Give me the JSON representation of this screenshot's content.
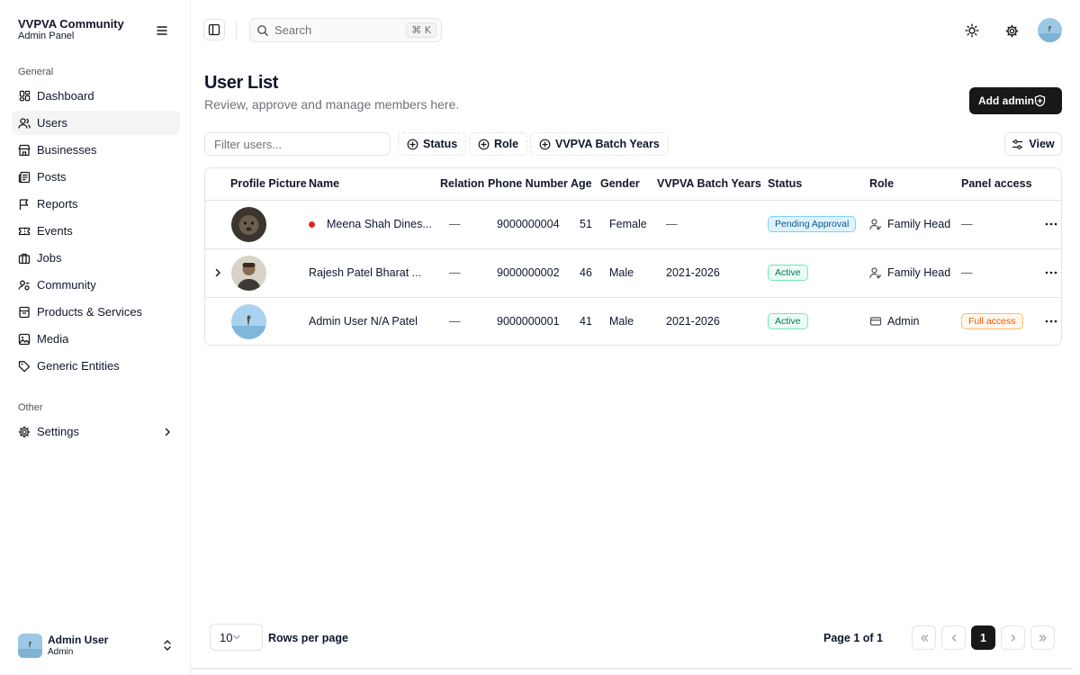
{
  "sidebar": {
    "title": "VVPVA Community",
    "subtitle": "Admin Panel",
    "group_general": "General",
    "group_other": "Other",
    "items": [
      {
        "label": "Dashboard",
        "icon": "dashboard-icon"
      },
      {
        "label": "Users",
        "icon": "users-icon",
        "active": true
      },
      {
        "label": "Businesses",
        "icon": "store-icon"
      },
      {
        "label": "Posts",
        "icon": "newspaper-icon"
      },
      {
        "label": "Reports",
        "icon": "flag-icon"
      },
      {
        "label": "Events",
        "icon": "ticket-icon"
      },
      {
        "label": "Jobs",
        "icon": "briefcase-icon"
      },
      {
        "label": "Community",
        "icon": "user-group-icon"
      },
      {
        "label": "Products & Services",
        "icon": "package-icon"
      },
      {
        "label": "Media",
        "icon": "image-icon"
      },
      {
        "label": "Generic Entities",
        "icon": "tag-icon"
      }
    ],
    "other_items": [
      {
        "label": "Settings",
        "icon": "gear-icon"
      }
    ],
    "user": {
      "name": "Admin User",
      "role": "Admin"
    }
  },
  "header": {
    "search_placeholder": "Search",
    "search_shortcut": "⌘ K"
  },
  "main": {
    "title": "User List",
    "subtitle": "Review, approve and manage members here.",
    "add_admin_label": "Add admin",
    "filter_placeholder": "Filter users...",
    "filter_chips": [
      "Status",
      "Role",
      "VVPVA Batch Years"
    ],
    "view_label": "View"
  },
  "table": {
    "columns": [
      "Profile Picture",
      "Name",
      "Relation",
      "Phone Number",
      "Age",
      "Gender",
      "VVPVA Batch Years",
      "Status",
      "Role",
      "Panel access"
    ],
    "rows": [
      {
        "name": "Meena Shah Dines...",
        "relation": "—",
        "phone": "9000000004",
        "age": "51",
        "gender": "Female",
        "batch": "—",
        "status": "Pending Approval",
        "role": "Family Head",
        "panel": "—"
      },
      {
        "name": "Rajesh Patel Bharat ...",
        "relation": "—",
        "phone": "9000000002",
        "age": "46",
        "gender": "Male",
        "batch": "2021-2026",
        "status": "Active",
        "role": "Family Head",
        "panel": "—"
      },
      {
        "name": "Admin User N/A Patel",
        "relation": "—",
        "phone": "9000000001",
        "age": "41",
        "gender": "Male",
        "batch": "2021-2026",
        "status": "Active",
        "role": "Admin",
        "panel": "Full access"
      }
    ]
  },
  "pagination": {
    "rows_per_page_value": "10",
    "rows_per_page_label": "Rows per page",
    "page_info": "Page 1 of 1",
    "current_page": "1"
  },
  "colors": {
    "primary": "#18181b",
    "pending": "#075985",
    "active": "#047857",
    "full_access": "#ea580c",
    "unread_dot": "#dc2626"
  }
}
